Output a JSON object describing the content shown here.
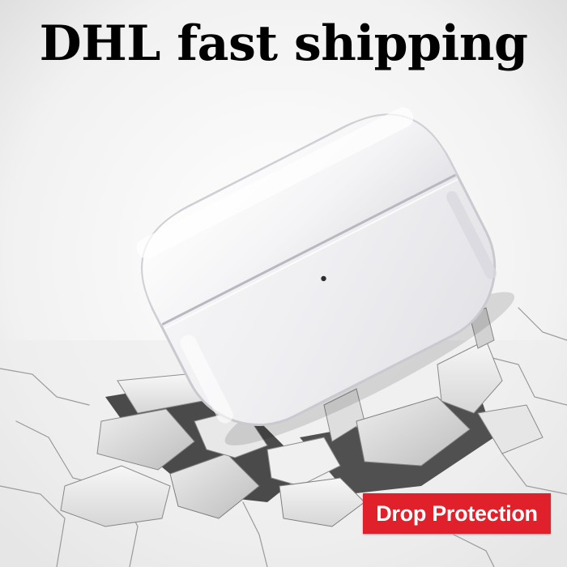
{
  "headline": "DHL fast shipping",
  "badge": {
    "label": "Drop Protection",
    "color": "#e0202a"
  },
  "image": {
    "subject": "clear-earbud-case",
    "background": "cracked-floor"
  }
}
